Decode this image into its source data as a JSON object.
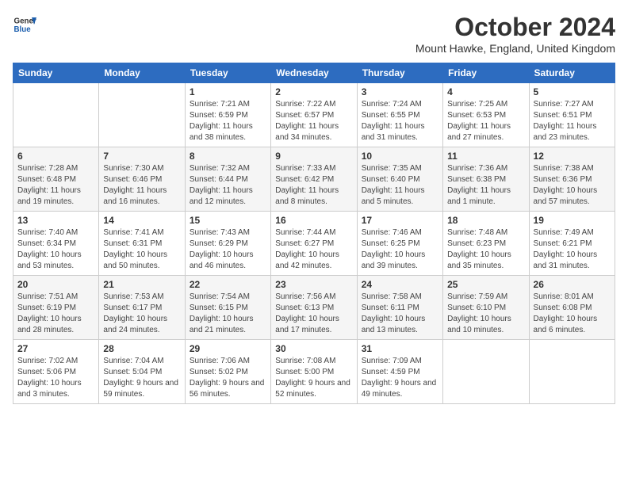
{
  "header": {
    "logo_line1": "General",
    "logo_line2": "Blue",
    "month_year": "October 2024",
    "location": "Mount Hawke, England, United Kingdom"
  },
  "weekdays": [
    "Sunday",
    "Monday",
    "Tuesday",
    "Wednesday",
    "Thursday",
    "Friday",
    "Saturday"
  ],
  "weeks": [
    [
      {
        "day": "",
        "info": ""
      },
      {
        "day": "",
        "info": ""
      },
      {
        "day": "1",
        "info": "Sunrise: 7:21 AM\nSunset: 6:59 PM\nDaylight: 11 hours and 38 minutes."
      },
      {
        "day": "2",
        "info": "Sunrise: 7:22 AM\nSunset: 6:57 PM\nDaylight: 11 hours and 34 minutes."
      },
      {
        "day": "3",
        "info": "Sunrise: 7:24 AM\nSunset: 6:55 PM\nDaylight: 11 hours and 31 minutes."
      },
      {
        "day": "4",
        "info": "Sunrise: 7:25 AM\nSunset: 6:53 PM\nDaylight: 11 hours and 27 minutes."
      },
      {
        "day": "5",
        "info": "Sunrise: 7:27 AM\nSunset: 6:51 PM\nDaylight: 11 hours and 23 minutes."
      }
    ],
    [
      {
        "day": "6",
        "info": "Sunrise: 7:28 AM\nSunset: 6:48 PM\nDaylight: 11 hours and 19 minutes."
      },
      {
        "day": "7",
        "info": "Sunrise: 7:30 AM\nSunset: 6:46 PM\nDaylight: 11 hours and 16 minutes."
      },
      {
        "day": "8",
        "info": "Sunrise: 7:32 AM\nSunset: 6:44 PM\nDaylight: 11 hours and 12 minutes."
      },
      {
        "day": "9",
        "info": "Sunrise: 7:33 AM\nSunset: 6:42 PM\nDaylight: 11 hours and 8 minutes."
      },
      {
        "day": "10",
        "info": "Sunrise: 7:35 AM\nSunset: 6:40 PM\nDaylight: 11 hours and 5 minutes."
      },
      {
        "day": "11",
        "info": "Sunrise: 7:36 AM\nSunset: 6:38 PM\nDaylight: 11 hours and 1 minute."
      },
      {
        "day": "12",
        "info": "Sunrise: 7:38 AM\nSunset: 6:36 PM\nDaylight: 10 hours and 57 minutes."
      }
    ],
    [
      {
        "day": "13",
        "info": "Sunrise: 7:40 AM\nSunset: 6:34 PM\nDaylight: 10 hours and 53 minutes."
      },
      {
        "day": "14",
        "info": "Sunrise: 7:41 AM\nSunset: 6:31 PM\nDaylight: 10 hours and 50 minutes."
      },
      {
        "day": "15",
        "info": "Sunrise: 7:43 AM\nSunset: 6:29 PM\nDaylight: 10 hours and 46 minutes."
      },
      {
        "day": "16",
        "info": "Sunrise: 7:44 AM\nSunset: 6:27 PM\nDaylight: 10 hours and 42 minutes."
      },
      {
        "day": "17",
        "info": "Sunrise: 7:46 AM\nSunset: 6:25 PM\nDaylight: 10 hours and 39 minutes."
      },
      {
        "day": "18",
        "info": "Sunrise: 7:48 AM\nSunset: 6:23 PM\nDaylight: 10 hours and 35 minutes."
      },
      {
        "day": "19",
        "info": "Sunrise: 7:49 AM\nSunset: 6:21 PM\nDaylight: 10 hours and 31 minutes."
      }
    ],
    [
      {
        "day": "20",
        "info": "Sunrise: 7:51 AM\nSunset: 6:19 PM\nDaylight: 10 hours and 28 minutes."
      },
      {
        "day": "21",
        "info": "Sunrise: 7:53 AM\nSunset: 6:17 PM\nDaylight: 10 hours and 24 minutes."
      },
      {
        "day": "22",
        "info": "Sunrise: 7:54 AM\nSunset: 6:15 PM\nDaylight: 10 hours and 21 minutes."
      },
      {
        "day": "23",
        "info": "Sunrise: 7:56 AM\nSunset: 6:13 PM\nDaylight: 10 hours and 17 minutes."
      },
      {
        "day": "24",
        "info": "Sunrise: 7:58 AM\nSunset: 6:11 PM\nDaylight: 10 hours and 13 minutes."
      },
      {
        "day": "25",
        "info": "Sunrise: 7:59 AM\nSunset: 6:10 PM\nDaylight: 10 hours and 10 minutes."
      },
      {
        "day": "26",
        "info": "Sunrise: 8:01 AM\nSunset: 6:08 PM\nDaylight: 10 hours and 6 minutes."
      }
    ],
    [
      {
        "day": "27",
        "info": "Sunrise: 7:02 AM\nSunset: 5:06 PM\nDaylight: 10 hours and 3 minutes."
      },
      {
        "day": "28",
        "info": "Sunrise: 7:04 AM\nSunset: 5:04 PM\nDaylight: 9 hours and 59 minutes."
      },
      {
        "day": "29",
        "info": "Sunrise: 7:06 AM\nSunset: 5:02 PM\nDaylight: 9 hours and 56 minutes."
      },
      {
        "day": "30",
        "info": "Sunrise: 7:08 AM\nSunset: 5:00 PM\nDaylight: 9 hours and 52 minutes."
      },
      {
        "day": "31",
        "info": "Sunrise: 7:09 AM\nSunset: 4:59 PM\nDaylight: 9 hours and 49 minutes."
      },
      {
        "day": "",
        "info": ""
      },
      {
        "day": "",
        "info": ""
      }
    ]
  ]
}
